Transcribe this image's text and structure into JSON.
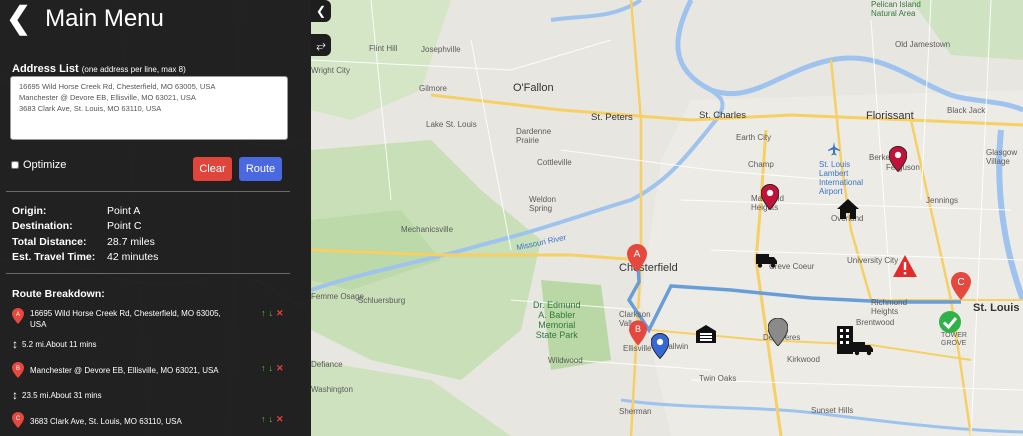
{
  "header": {
    "title": "Main Menu"
  },
  "address": {
    "label": "Address List",
    "hint": "(one address per line, max 8)",
    "value": "16695 Wild Horse Creek Rd, Chesterfield, MO 63005, USA\nManchester @ Devore EB, Ellisville, MO 63021, USA\n3683 Clark Ave, St. Louis, MO 63110, USA"
  },
  "optimize_label": "Optimize",
  "buttons": {
    "clear": "Clear",
    "route": "Route"
  },
  "summary": {
    "origin_label": "Origin:",
    "origin": "Point A",
    "destination_label": "Destination:",
    "destination": "Point C",
    "distance_label": "Total Distance:",
    "distance": "28.7 miles",
    "time_label": "Est. Travel Time:",
    "time": "42 minutes"
  },
  "breakdown": {
    "title": "Route Breakdown:",
    "stops": [
      {
        "letter": "A",
        "address": "16695 Wild Horse Creek Rd, Chesterfield, MO 63005, USA"
      },
      {
        "letter": "B",
        "address": "Manchester @ Devore EB, Ellisville, MO 63021, USA"
      },
      {
        "letter": "C",
        "address": "3683 Clark Ave, St. Louis, MO 63110, USA"
      }
    ],
    "segments": [
      "5.2 mi.About 11 mins",
      "23.5 mi.About 31 mins"
    ]
  },
  "map": {
    "labels": {
      "pelican": "Pelican Island\nNatural Area",
      "old_jamestown": "Old Jamestown",
      "flint_hill": "Flint Hill",
      "josephville": "Josephville",
      "wright_city": "Wright City",
      "ofallon": "O'Fallon",
      "gilmore": "Gilmore",
      "st_peters": "St. Peters",
      "st_charles": "St. Charles",
      "lake_st_louis": "Lake St. Louis",
      "dardenne": "Dardenne\nPrairie",
      "cottleville": "Cottleville",
      "weldon": "Weldon\nSpring",
      "earth_city": "Earth City",
      "champ": "Champ",
      "florissant": "Florissant",
      "black_jack": "Black Jack",
      "airport": "St. Louis\nLambert\nInternational\nAirport",
      "berkeley": "Berkeley",
      "ferguson": "Ferguson",
      "glasgow": "Glasgow\nVillage",
      "jennings": "Jennings",
      "maryland": "Maryland\nHeights",
      "overland": "Overland",
      "creve": "Creve Coeur",
      "mechanicsville": "Mechanicsville",
      "chesterfield": "Chesterfield",
      "university": "University City",
      "richmond": "Richmond\nHeights",
      "st_louis": "St. Louis",
      "clarkson": "Clarkson\nValley",
      "ellisville": "Ellisville",
      "ballwin": "Ballwin",
      "dr_edmund": "Dr. Edmund\nA. Babler\nMemorial\nState Park",
      "schluersburg": "Schluersburg",
      "femme_osage": "Femme Osage",
      "defiance": "Defiance",
      "des_peres": "Des Peres",
      "brentwood": "Brentwood",
      "kirkwood": "Kirkwood",
      "wildwood": "Wildwood",
      "twin_oaks": "Twin Oaks",
      "tower_grove": "TOWER\nGROVE",
      "sunset_hills": "Sunset Hills",
      "sherman": "Sherman",
      "washington": "Washington",
      "missouri_river": "Missouri River"
    }
  }
}
